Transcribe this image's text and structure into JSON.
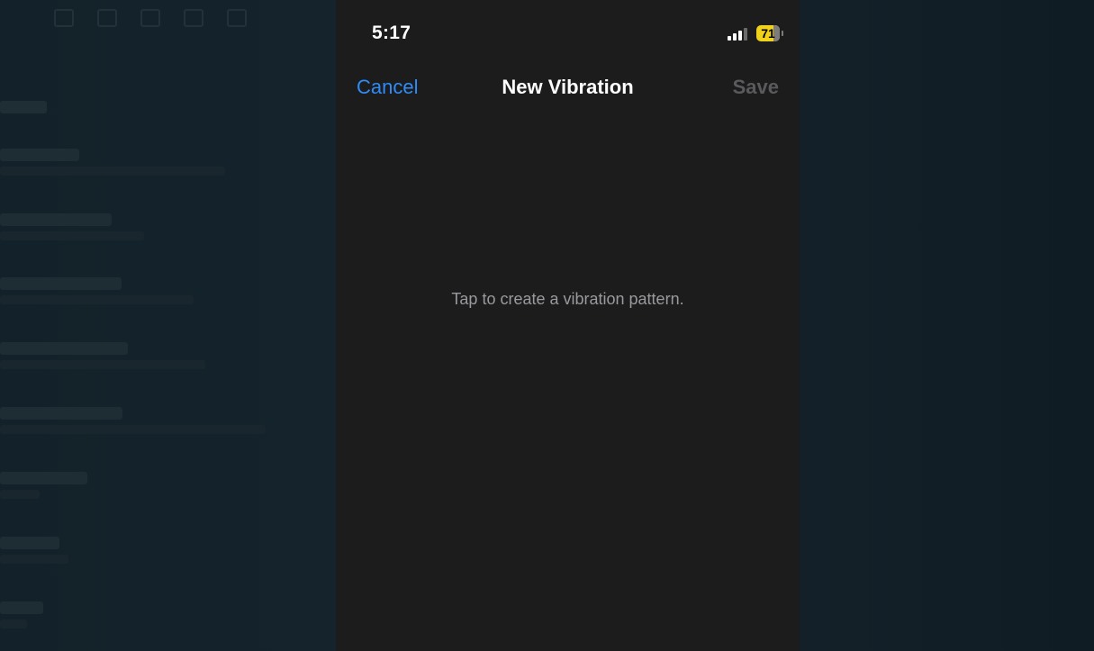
{
  "status_bar": {
    "time": "5:17",
    "battery_percent": "71",
    "signal_bars_active": 3,
    "signal_bars_total": 4
  },
  "nav": {
    "cancel_label": "Cancel",
    "title": "New Vibration",
    "save_label": "Save"
  },
  "hint": "Tap to create a vibration pattern.",
  "colors": {
    "accent": "#2f8cf6",
    "disabled": "#5a5a5d",
    "battery": "#f1d21a",
    "sheet_background": "#1c1c1d"
  },
  "icons": [
    "signal-strength-icon",
    "battery-icon"
  ]
}
